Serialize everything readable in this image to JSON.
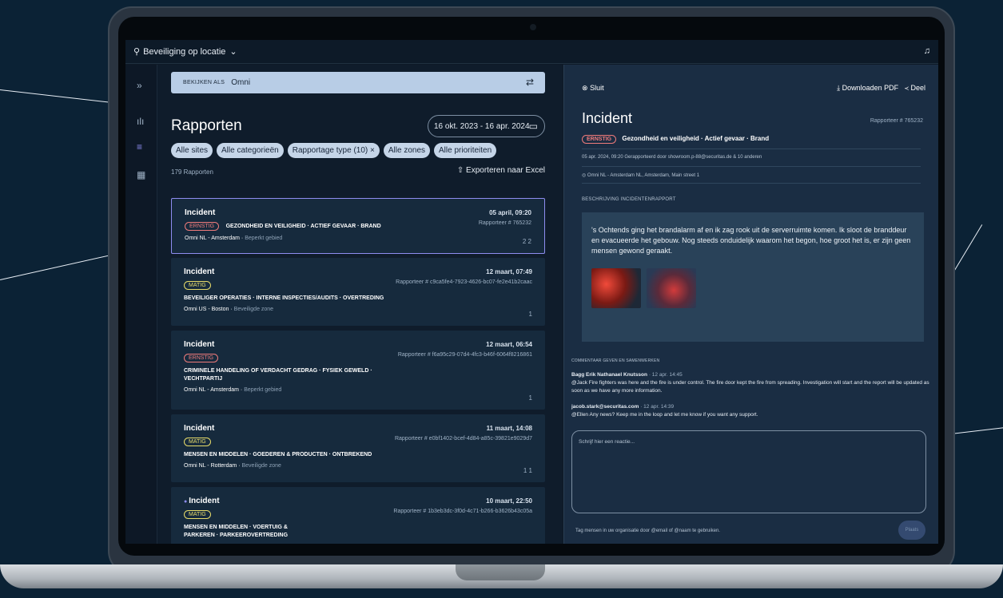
{
  "app": {
    "title": "Beveiliging op locatie"
  },
  "view_as": {
    "label": "BEKIJKEN ALS",
    "value": "Omni"
  },
  "reports": {
    "title": "Rapporten",
    "date_range": "16 okt. 2023 - 16 apr. 2024",
    "filters": [
      "Alle sites",
      "Alle categorieën",
      "Rapportage type (10)",
      "Alle zones",
      "Alle prioriteiten"
    ],
    "count": "179 Rapporten",
    "export": "Exporteren naar Excel",
    "items": [
      {
        "title": "Incident",
        "date": "05 april,  09:20",
        "reporter": "Rapporteer # 765232",
        "priority": "ERNSTIG",
        "categories": "GEZONDHEID EN VEILIGHEID · ACTIEF GEVAAR · BRAND",
        "site": "Omni NL - Amsterdam",
        "zone": "Beperkt gebied",
        "icons": "2  2"
      },
      {
        "title": "Incident",
        "date": "12 maart,  07:49",
        "reporter": "Rapporteer # c9ca5fe4-7923-4626-bc07-fe2e41b2caac",
        "priority": "MATIG",
        "categories": "BEVEILIGER OPERATIES · INTERNE INSPECTIES/AUDITS · OVERTREDING",
        "site": "Omni US - Boston",
        "zone": "Beveiligde zone",
        "icons": "1"
      },
      {
        "title": "Incident",
        "date": "12 maart,  06:54",
        "reporter": "Rapporteer # f6a95c29-07d4-4fc3-b46f-6064f8216861",
        "priority": "ERNSTIG",
        "categories": "CRIMINELE HANDELING OF VERDACHT GEDRAG · FYSIEK GEWELD · VECHTPARTIJ",
        "site": "Omni NL - Amsterdam",
        "zone": "Beperkt gebied",
        "icons": "1"
      },
      {
        "title": "Incident",
        "date": "11 maart,  14:08",
        "reporter": "Rapporteer # e0bf1402-bcef-4d84-a85c-39821e9029d7",
        "priority": "MATIG",
        "categories": "MENSEN EN MIDDELEN · GOEDEREN & PRODUCTEN · ONTBREKEND",
        "site": "Omni NL - Rotterdam",
        "zone": "Beveiligde zone",
        "icons": "1  1"
      },
      {
        "title": "Incident",
        "date": "10 maart,  22:50",
        "reporter": "Rapporteer # 1b3eb3dc-3f0d-4c71-b266-b3626b43c05a",
        "priority": "MATIG",
        "categories": "MENSEN EN MIDDELEN · VOERTUIG & PARKEREN · PARKEEROVERTREDING",
        "site": "",
        "zone": "",
        "icons": ""
      }
    ]
  },
  "detail": {
    "close": "Sluit",
    "download": "Downloaden PDF",
    "share": "Deel",
    "title": "Incident",
    "reporter": "Rapporteer # 765232",
    "priority": "ERNSTIG",
    "tags": "Gezondheid en veiligheid  ·  Actief gevaar  ·  Brand",
    "meta": "05 apr. 2024, 09:20     Gerapporteerd door      showroom.p-88@securitas.de & 10 anderen",
    "location": "Omni NL - Amsterdam     NL, Amsterdam, Main street 1",
    "section": "BESCHRIJVING INCIDENTENRAPPORT",
    "description": "'s Ochtends ging het brandalarm af en ik zag rook uit de serverruimte komen. Ik sloot de branddeur en evacueerde het gebouw. Nog steeds onduidelijk waarom het begon, hoe groot het is, er zijn geen mensen gewond geraakt.",
    "comments_header": "COMMENTAAR GEVEN EN SAMENWERKEN",
    "comments": [
      {
        "author": "Bagg Erik Nathanael Knutsson",
        "time": "· 12 apr. 14:45",
        "text": "@Jack Fire fighters was here and the fire is under control. The fire door kept the fire from spreading. Investigation will start and the report will be updated as soon as we have any more information."
      },
      {
        "author": "jacob.stark@securitas.com",
        "time": "· 12 apr. 14:39",
        "text": "@Ellen Any news? Keep me in the loop and let me know if you want any support."
      }
    ],
    "placeholder": "Schrijf hier een reactie...",
    "hint": "Tag mensen in uw organisatie door @email of @naam te gebruiken.",
    "post": "Plaats"
  }
}
